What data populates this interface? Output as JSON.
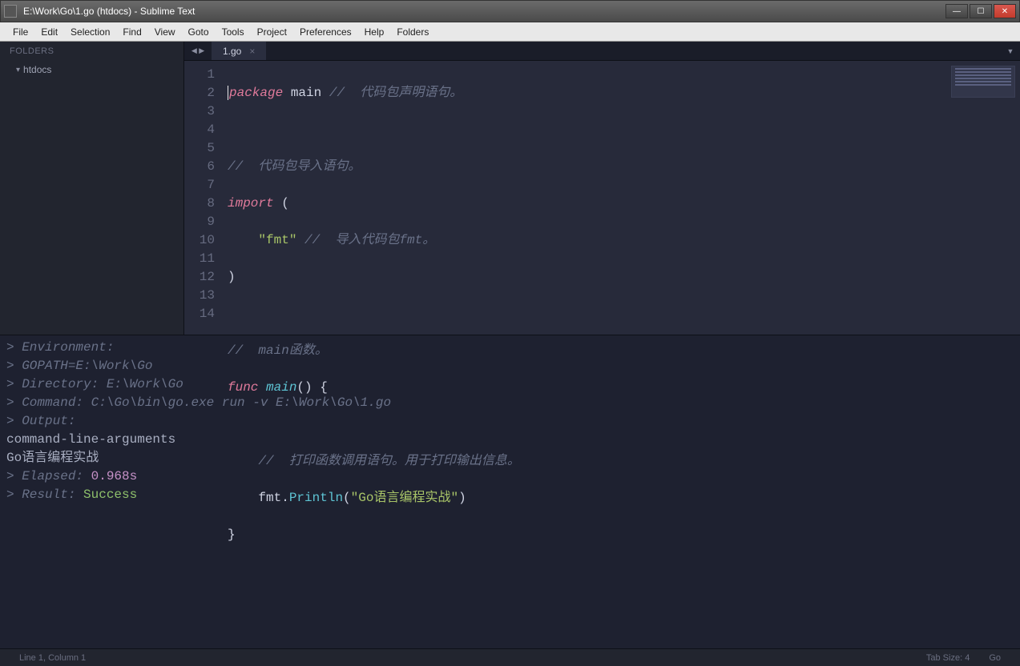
{
  "window": {
    "title": "E:\\Work\\Go\\1.go (htdocs) - Sublime Text"
  },
  "menu": [
    "File",
    "Edit",
    "Selection",
    "Find",
    "View",
    "Goto",
    "Tools",
    "Project",
    "Preferences",
    "Help",
    "Folders"
  ],
  "sidebar": {
    "header": "FOLDERS",
    "items": [
      {
        "label": "htdocs"
      }
    ]
  },
  "tabs": [
    {
      "label": "1.go"
    }
  ],
  "code": {
    "lines": [
      "1",
      "2",
      "3",
      "4",
      "5",
      "6",
      "7",
      "8",
      "9",
      "10",
      "11",
      "12",
      "13",
      "14"
    ],
    "l1_kw": "package",
    "l1_ident": "main",
    "l1_comment": "//  代码包声明语句。",
    "l3_comment": "//  代码包导入语句。",
    "l4_kw": "import",
    "l4_punct": "(",
    "l5_str": "\"fmt\"",
    "l5_comment": "//  导入代码包fmt。",
    "l6_punct": ")",
    "l8_comment": "//  main函数。",
    "l9_kw": "func",
    "l9_name": "main",
    "l9_parens": "()",
    "l9_brace": "{",
    "l11_comment": "//  打印函数调用语句。用于打印输出信息。",
    "l12_recv": "fmt",
    "l12_dot": ".",
    "l12_call": "Println",
    "l12_open": "(",
    "l12_str": "\"Go语言编程实战\"",
    "l12_close": ")",
    "l13_brace": "}"
  },
  "console": {
    "l1": ">  Environment:",
    "l2": ">    GOPATH=E:\\Work\\Go",
    "l3": ">  Directory: E:\\Work\\Go",
    "l4": ">  Command: C:\\Go\\bin\\go.exe run -v E:\\Work\\Go\\1.go",
    "l5": ">  Output:",
    "l6": "command-line-arguments",
    "l7": "Go语言编程实战",
    "l8_label": ">  Elapsed: ",
    "l8_value": "0.968s",
    "l9_label": ">  Result: ",
    "l9_value": "Success"
  },
  "status": {
    "left": "Line 1, Column 1",
    "tab_size": "Tab Size: 4",
    "lang": "Go"
  }
}
